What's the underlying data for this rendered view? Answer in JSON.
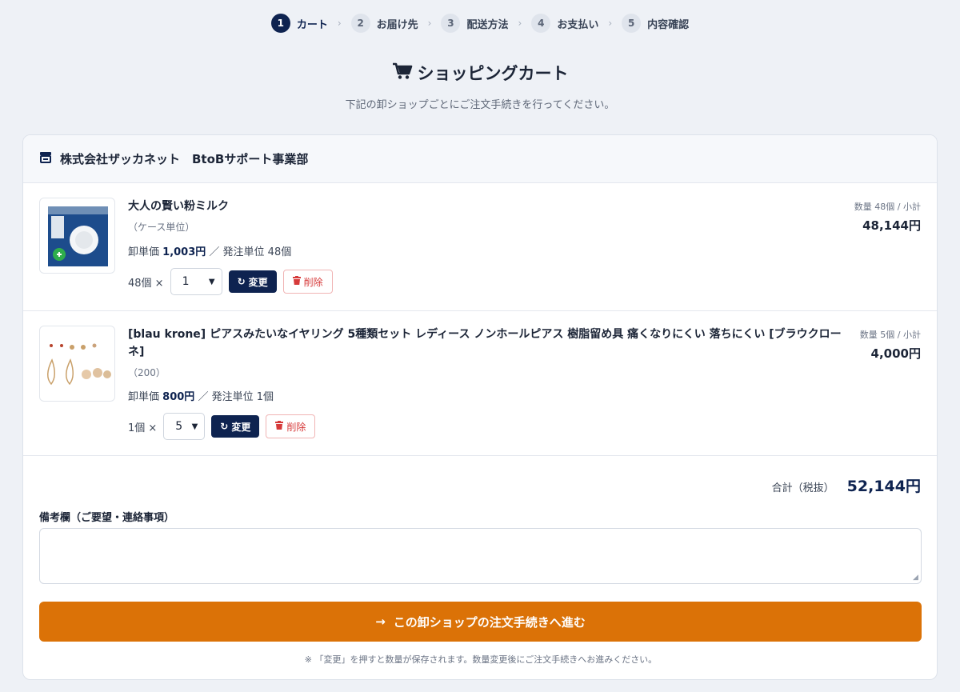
{
  "steps": [
    {
      "num": "1",
      "label": "カート"
    },
    {
      "num": "2",
      "label": "お届け先"
    },
    {
      "num": "3",
      "label": "配送方法"
    },
    {
      "num": "4",
      "label": "お支払い"
    },
    {
      "num": "5",
      "label": "内容確認"
    }
  ],
  "page": {
    "title": "ショッピングカート",
    "subtitle": "下記の卸ショップごとにご注文手続きを行ってください。"
  },
  "shop": {
    "name": "株式会社ザッカネット　BtoBサポート事業部"
  },
  "items": [
    {
      "name": "大人の賢い粉ミルク",
      "variant": "（ケース単位）",
      "price_label": "卸単価",
      "price": "1,003円",
      "unit_text": "／ 発注単位 48個",
      "qty_prefix": "48個 ×",
      "qty_selected": "1",
      "qty_meta": "数量 48個 / 小計",
      "subtotal": "48,144円"
    },
    {
      "name": "[blau krone] ピアスみたいなイヤリング 5種類セット レディース ノンホールピアス 樹脂留め具 痛くなりにくい 落ちにくい [ブラウクローネ]",
      "variant": "（200）",
      "price_label": "卸単価",
      "price": "800円",
      "unit_text": "／ 発注単位 1個",
      "qty_prefix": "1個 ×",
      "qty_selected": "5",
      "qty_meta": "数量 5個 / 小計",
      "subtotal": "4,000円"
    }
  ],
  "buttons": {
    "update": "変更",
    "delete": "削除",
    "proceed": "この卸ショップの注文手続きへ進む"
  },
  "total": {
    "label": "合計（税抜）",
    "value": "52,144円"
  },
  "notes": {
    "label": "備考欄（ご要望・連絡事項）",
    "value": ""
  },
  "footnote": "※ 「変更」を押すと数量が保存されます。数量変更後にご注文手続きへお進みください。",
  "colors": {
    "navy": "#0e2350",
    "orange": "#db7207",
    "danger": "#d63a3a"
  }
}
